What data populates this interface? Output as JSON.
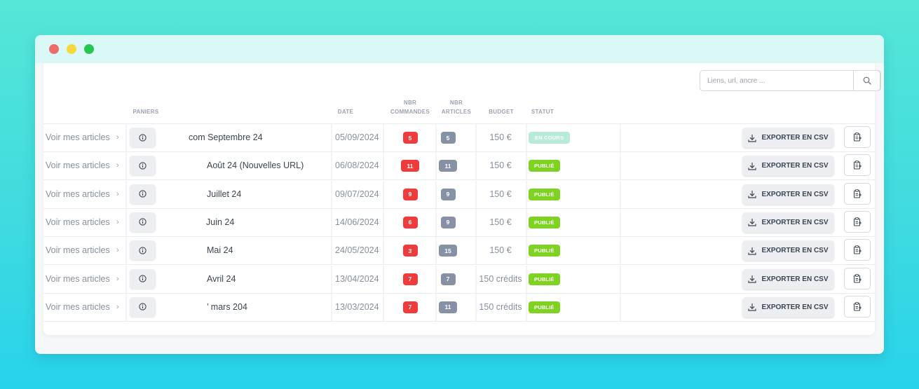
{
  "window": {
    "controls": [
      "close",
      "minimize",
      "maximize"
    ]
  },
  "search": {
    "placeholder": "Liens, url, ancre ...",
    "value": "",
    "icon": "search-icon"
  },
  "table": {
    "headers": {
      "paniers": "PANIERS",
      "date": "DATE",
      "nbr_commandes_1": "NBR",
      "nbr_commandes_2": "COMMANDES",
      "nbr_articles_1": "NBR",
      "nbr_articles_2": "ARTICLES",
      "budget": "BUDGET",
      "statut": "STATUT"
    },
    "rows": [
      {
        "link": "Voir mes articles",
        "name": "com Septembre 24",
        "date": "05/09/2024",
        "commandes": "5",
        "articles": "5",
        "budget": "150 €",
        "status": "EN COURS",
        "status_color": "#b7ebd8",
        "export": "EXPORTER EN CSV"
      },
      {
        "link": "Voir mes articles",
        "name": "Août 24 (Nouvelles URL)",
        "date": "06/08/2024",
        "commandes": "11",
        "articles": "11",
        "budget": "150 €",
        "status": "PUBLIÉ",
        "status_color": "#7ed321",
        "export": "EXPORTER EN CSV"
      },
      {
        "link": "Voir mes articles",
        "name": "Juillet 24",
        "date": "09/07/2024",
        "commandes": "9",
        "articles": "9",
        "budget": "150 €",
        "status": "PUBLIÉ",
        "status_color": "#7ed321",
        "export": "EXPORTER EN CSV"
      },
      {
        "link": "Voir mes articles",
        "name": "Juin 24",
        "date": "14/06/2024",
        "commandes": "6",
        "articles": "9",
        "budget": "150 €",
        "status": "PUBLIÉ",
        "status_color": "#7ed321",
        "export": "EXPORTER EN CSV"
      },
      {
        "link": "Voir mes articles",
        "name": "Mai 24",
        "date": "24/05/2024",
        "commandes": "3",
        "articles": "15",
        "budget": "150 €",
        "status": "PUBLIÉ",
        "status_color": "#7ed321",
        "export": "EXPORTER EN CSV"
      },
      {
        "link": "Voir mes articles",
        "name": "Avril 24",
        "date": "13/04/2024",
        "commandes": "7",
        "articles": "7",
        "budget": "150 crédits",
        "status": "PUBLIÉ",
        "status_color": "#7ed321",
        "export": "EXPORTER EN CSV"
      },
      {
        "link": "Voir mes articles",
        "name": "’ mars 204",
        "date": "13/03/2024",
        "commandes": "7",
        "articles": "11",
        "budget": "150 crédits",
        "status": "PUBLIÉ",
        "status_color": "#7ed321",
        "export": "EXPORTER EN CSV"
      }
    ]
  },
  "colors": {
    "background_top": "#55e6d6",
    "background_bottom": "#27d3ea",
    "titlebar": "#d9f8f6",
    "badge_red": "#ef3b3b",
    "badge_gray": "#8791a6",
    "status_published": "#7ed321",
    "status_in_progress": "#b7ebd8"
  }
}
